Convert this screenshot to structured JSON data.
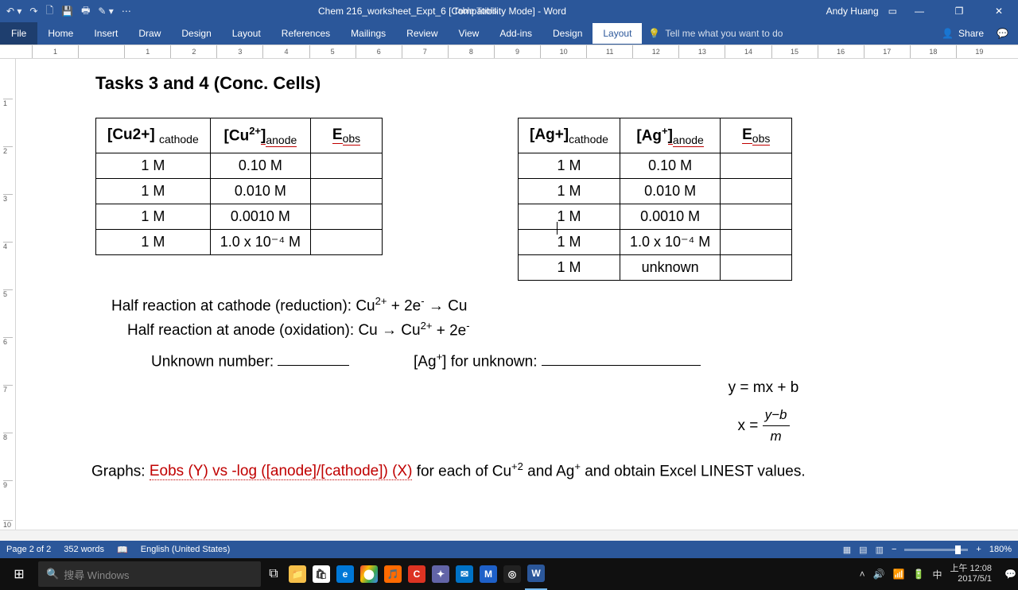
{
  "titlebar": {
    "doc": "Chem 216_worksheet_Expt_6 [Compatibility Mode] - Word",
    "tabletools": "Table Tools",
    "user": "Andy Huang"
  },
  "ribbon": {
    "file": "File",
    "tabs": [
      "Home",
      "Insert",
      "Draw",
      "Design",
      "Layout",
      "References",
      "Mailings",
      "Review",
      "View",
      "Add-ins",
      "Design",
      "Layout"
    ],
    "tellme": "Tell me what you want to do",
    "share": "Share"
  },
  "doc": {
    "heading": "Tasks 3 and 4 (Conc. Cells)",
    "table1": {
      "h1": "[Cu2+]",
      "h1sub": "cathode",
      "h2a": "[Cu",
      "h2sup": "2+",
      "h2b": "]",
      "h2sub": "anode",
      "h3": "E",
      "h3sub": "obs",
      "rows": [
        [
          "1 M",
          "0.10 M",
          ""
        ],
        [
          "1 M",
          "0.010 M",
          ""
        ],
        [
          "1 M",
          "0.0010 M",
          ""
        ],
        [
          "1 M",
          "1.0 x 10⁻⁴ M",
          ""
        ]
      ]
    },
    "table2": {
      "h1": "[Ag+]",
      "h1sub": "cathode",
      "h2a": "[Ag",
      "h2sup": "+",
      "h2b": "]",
      "h2sub": "anode",
      "h3": "E",
      "h3sub": "obs",
      "rows": [
        [
          "1 M",
          "0.10 M",
          ""
        ],
        [
          "1 M",
          "0.010 M",
          ""
        ],
        [
          "1 M",
          "0.0010 M",
          ""
        ],
        [
          "1 M",
          "1.0 x 10⁻⁴ M",
          ""
        ],
        [
          "1 M",
          "unknown",
          ""
        ]
      ]
    },
    "hr_cathode_a": "Half reaction at cathode (reduction): Cu",
    "hr_cathode_b": " + 2e",
    "hr_cathode_c": " → Cu",
    "hr_anode_a": "Half reaction at anode (oxidation): Cu → Cu",
    "hr_anode_b": " + 2e",
    "unknown": "Unknown number: ",
    "ag_unknown_a": "[Ag",
    "ag_unknown_b": "] for unknown: ",
    "eq1": "y = mx + b",
    "eq2_lhs": "x  =  ",
    "graphs_a": "Graphs:  ",
    "graphs_red": "Eobs (Y) vs -log ([anode]/[cathode]) (X)",
    "graphs_b_1": " for each of Cu",
    "graphs_b_2": " and Ag",
    "graphs_b_3": " and obtain Excel LINEST values."
  },
  "status": {
    "page": "Page 2 of 2",
    "words": "352 words",
    "lang": "English (United States)",
    "zoom": "180%"
  },
  "taskbar": {
    "search": "搜尋 Windows",
    "time": "上午 12:08",
    "date": "2017/5/1"
  }
}
